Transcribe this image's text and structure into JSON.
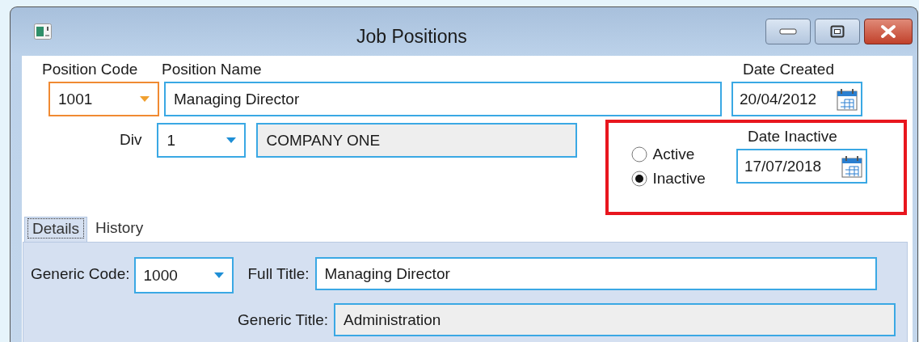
{
  "window": {
    "title": "Job Positions"
  },
  "position_code": {
    "label": "Position Code",
    "value": "1001",
    "focused": true
  },
  "position_name": {
    "label": "Position Name",
    "value": "Managing Director"
  },
  "date_created": {
    "label": "Date Created",
    "value": "20/04/2012"
  },
  "div": {
    "label": "Div",
    "value": "1",
    "name": "COMPANY ONE"
  },
  "status": [
    {
      "label": "Active",
      "selected": false
    },
    {
      "label": "Inactive",
      "selected": true
    }
  ],
  "date_inactive": {
    "label": "Date Inactive",
    "value": "17/07/2018"
  },
  "tabs": [
    {
      "label": "Details",
      "selected": true
    },
    {
      "label": "History",
      "selected": false
    }
  ],
  "details": {
    "generic_code": {
      "label": "Generic Code:",
      "value": "1000"
    },
    "full_title": {
      "label": "Full Title:",
      "value": "Managing Director"
    },
    "generic_title": {
      "label": "Generic Title:",
      "value": "Administration"
    }
  }
}
